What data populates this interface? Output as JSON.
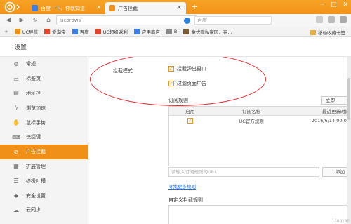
{
  "browser": {
    "tabs": [
      {
        "label": "百度一下，你就知道",
        "active": false,
        "favicon_color": "#3b7ee8"
      },
      {
        "label": "广告拦截",
        "active": true,
        "favicon_color": "#f29318"
      }
    ],
    "window_controls": [
      "─",
      "□",
      "✕"
    ],
    "address": {
      "url": "ucbrows"
    },
    "search": {
      "text": "百度"
    },
    "bookmarks": [
      {
        "label": "UC导航",
        "icon_color": "#f29318"
      },
      {
        "label": "爱淘宝",
        "icon_color": "#e6432d"
      },
      {
        "label": "百度",
        "icon_color": "#3b7ee8"
      },
      {
        "label": "UC超级返利",
        "icon_color": "#e6432d"
      },
      {
        "label": "应用商店",
        "icon_color": "#3b7ee8"
      },
      {
        "label": "B",
        "icon_color": "#8a8a8a"
      },
      {
        "label": "金优隐私家园，在...",
        "icon_color": "#7a5b35"
      }
    ],
    "bookmark_right": "移动收藏书签"
  },
  "settings": {
    "title": "设置",
    "sidebar": [
      {
        "label": "常规",
        "icon": "gear-icon",
        "glyph": "⚙",
        "active": false
      },
      {
        "label": "标签页",
        "icon": "tab-icon",
        "glyph": "▭",
        "active": false
      },
      {
        "label": "地址栏",
        "icon": "address-bar-icon",
        "glyph": "▤",
        "active": false
      },
      {
        "label": "浏览加速",
        "icon": "lightning-icon",
        "glyph": "ϟ",
        "active": false
      },
      {
        "label": "鼠标手势",
        "icon": "mouse-icon",
        "glyph": "✋",
        "active": false
      },
      {
        "label": "快捷键",
        "icon": "keyboard-icon",
        "glyph": "⌨",
        "active": false
      },
      {
        "label": "广告拦截",
        "icon": "block-icon",
        "glyph": "⊘",
        "active": true
      },
      {
        "label": "扩展管理",
        "icon": "extension-icon",
        "glyph": "▦",
        "active": false
      },
      {
        "label": "终极吐槽",
        "icon": "chat-icon",
        "glyph": "☰",
        "active": false
      },
      {
        "label": "安全设置",
        "icon": "shield-icon",
        "glyph": "◆",
        "active": false
      },
      {
        "label": "云同步",
        "icon": "cloud-icon",
        "glyph": "☁",
        "active": false
      }
    ],
    "adblock": {
      "section_label": "拦截模式",
      "options": [
        {
          "label": "拦截弹出窗口",
          "checked": true
        },
        {
          "label": "过滤页面广告",
          "checked": true
        }
      ],
      "subscription_label": "订阅规则",
      "update_button": "立即",
      "table": {
        "headers": [
          "启用",
          "订阅名称",
          "最近更新时间"
        ],
        "rows": [
          {
            "enabled": true,
            "name": "UC官方规则",
            "updated": "2016/6/14 00:01"
          }
        ]
      },
      "url_placeholder": "请输入订阅规则的URL",
      "add_button": "添加",
      "more_link": "寻找更多规则",
      "custom_label": "自定义拦截规则"
    },
    "highlight_color": "#e8242a",
    "accent_color": "#f19019",
    "watermark": "jingyan"
  }
}
